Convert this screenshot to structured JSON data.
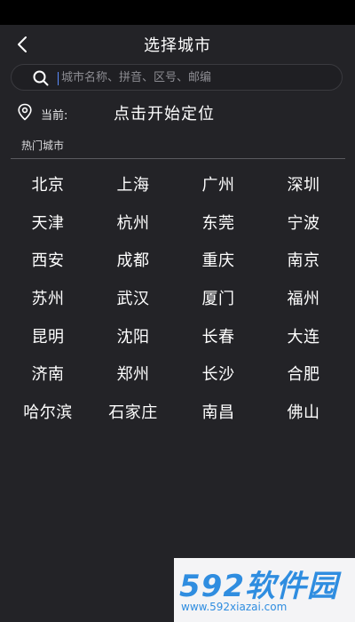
{
  "header": {
    "title": "选择城市"
  },
  "search": {
    "placeholder": "城市名称、拼音、区号、邮编",
    "value": ""
  },
  "location": {
    "label": "当前:",
    "action": "点击开始定位"
  },
  "hot": {
    "title": "热门城市",
    "cities": [
      "北京",
      "上海",
      "广州",
      "深圳",
      "天津",
      "杭州",
      "东莞",
      "宁波",
      "西安",
      "成都",
      "重庆",
      "南京",
      "苏州",
      "武汉",
      "厦门",
      "福州",
      "昆明",
      "沈阳",
      "长春",
      "大连",
      "济南",
      "郑州",
      "长沙",
      "合肥",
      "哈尔滨",
      "石家庄",
      "南昌",
      "佛山"
    ]
  },
  "watermark": {
    "logo": "592软件园",
    "url": "www.592xiazai.com"
  },
  "colors": {
    "background": "#232327",
    "statusbar": "#000000",
    "accent": "#2f8de0",
    "caret": "#5b8cff"
  },
  "icons": {
    "back": "chevron-left-icon",
    "search": "search-icon",
    "location": "location-pin-icon"
  }
}
